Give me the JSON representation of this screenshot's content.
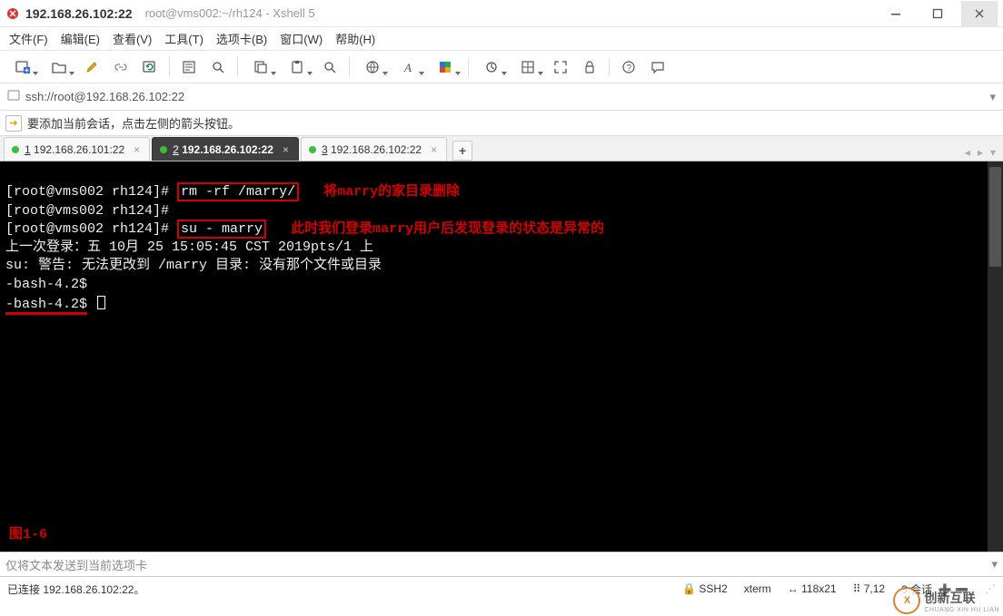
{
  "window": {
    "ip_title": "192.168.26.102:22",
    "path_title": "root@vms002:~/rh124 - Xshell 5"
  },
  "menu": {
    "file": "文件(F)",
    "edit": "编辑(E)",
    "view": "查看(V)",
    "tools": "工具(T)",
    "tabs_menu": "选项卡(B)",
    "window": "窗口(W)",
    "help": "帮助(H)"
  },
  "toolbar_icons": {
    "new_session": "new-session-icon",
    "open_folder": "open-folder-icon",
    "pencil": "pencil-icon",
    "link": "link-icon",
    "reconnect": "reconnect-icon",
    "properties": "properties-icon",
    "zoom": "zoom-icon",
    "copy": "copy-icon",
    "paste": "paste-icon",
    "find": "find-icon",
    "globe": "globe-icon",
    "font": "font-icon",
    "color": "color-scheme-icon",
    "circle": "session-icon",
    "layout": "layout-icon",
    "fullscreen": "fullscreen-icon",
    "lock": "lock-icon",
    "help": "help-icon",
    "chat": "chat-icon"
  },
  "address": {
    "scheme_icon": "ssh-icon",
    "url": "ssh://root@192.168.26.102:22"
  },
  "hint": {
    "text": "要添加当前会话，点击左侧的箭头按钮。"
  },
  "tabs": [
    {
      "index": "1",
      "label": "192.168.26.101:22",
      "active": false
    },
    {
      "index": "2",
      "label": "192.168.26.102:22",
      "active": true
    },
    {
      "index": "3",
      "label": "192.168.26.102:22",
      "active": false
    }
  ],
  "terminal": {
    "line1_prompt": "[root@vms002 rh124]#",
    "line1_cmd": "rm -rf /marry/",
    "line1_note": "将marry的家目录删除",
    "line2_prompt": "[root@vms002 rh124]#",
    "line3_prompt": "[root@vms002 rh124]#",
    "line3_cmd": "su - marry",
    "line3_note": "此时我们登录marry用户后发现登录的状态是异常的",
    "line4": "上一次登录：五 10月 25 15:05:45 CST 2019pts/1 上",
    "line5": "su: 警告: 无法更改到 /marry 目录: 没有那个文件或目录",
    "line6": "-bash-4.2$",
    "line7": "-bash-4.2$",
    "figure": "图1-6"
  },
  "inputbar": {
    "placeholder": "仅将文本发送到当前选项卡"
  },
  "status": {
    "left": "已连接 192.168.26.102:22。",
    "ssh": "SSH2",
    "term": "xterm",
    "size": "118x21",
    "pos": "7,12",
    "sessions": "3 会话"
  },
  "watermark": {
    "logo_letter": "X",
    "text1": "创新互联",
    "text2": "CHUANG XIN HU LIAN"
  }
}
